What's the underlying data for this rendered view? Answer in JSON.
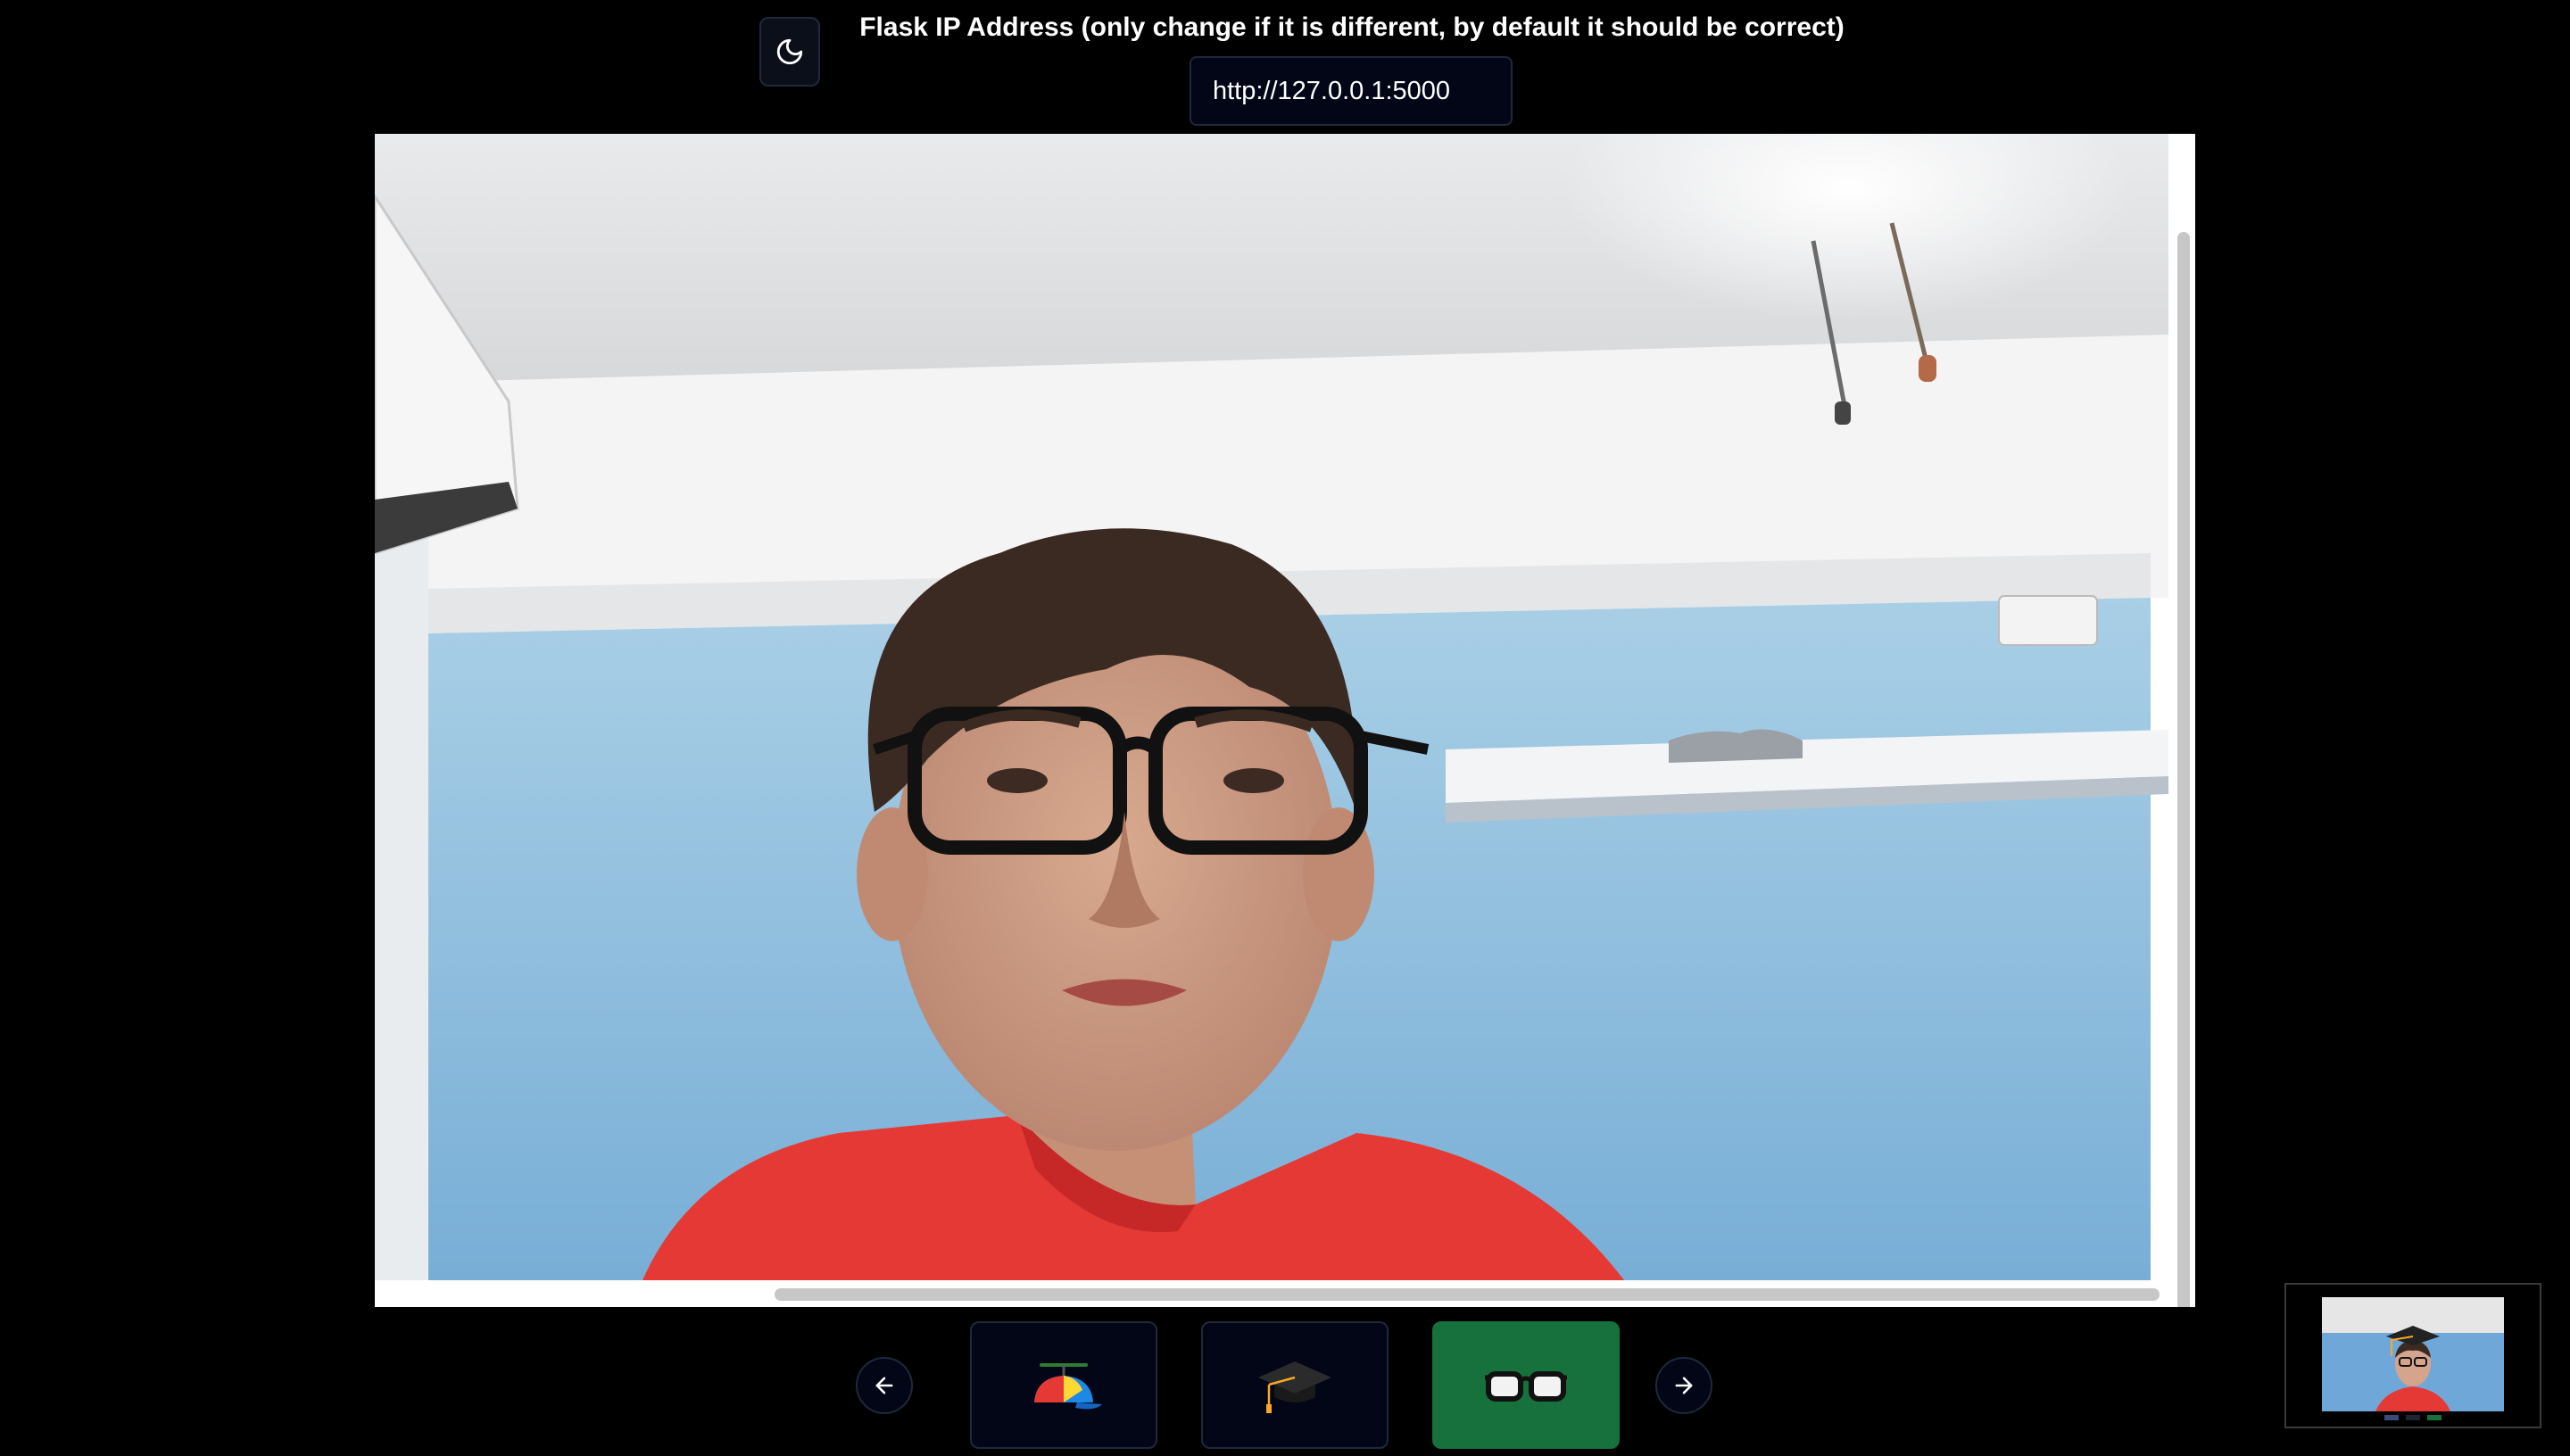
{
  "header": {
    "ip_label": "Flask IP Address (only change if it is different, by default it should be correct)",
    "ip_value": "http://127.0.0.1:5000",
    "theme_toggle_icon": "moon-icon"
  },
  "camera": {
    "feed_description_icon": "webcam-feed"
  },
  "carousel": {
    "prev_icon": "arrow-left-icon",
    "next_icon": "arrow-right-icon",
    "items": [
      {
        "icon": "propeller-hat-icon",
        "selected": false
      },
      {
        "icon": "graduation-cap-icon",
        "selected": false
      },
      {
        "icon": "glasses-icon",
        "selected": true
      }
    ],
    "selected_color": "#16713c"
  },
  "preview": {
    "icon": "preview-thumbnail"
  }
}
